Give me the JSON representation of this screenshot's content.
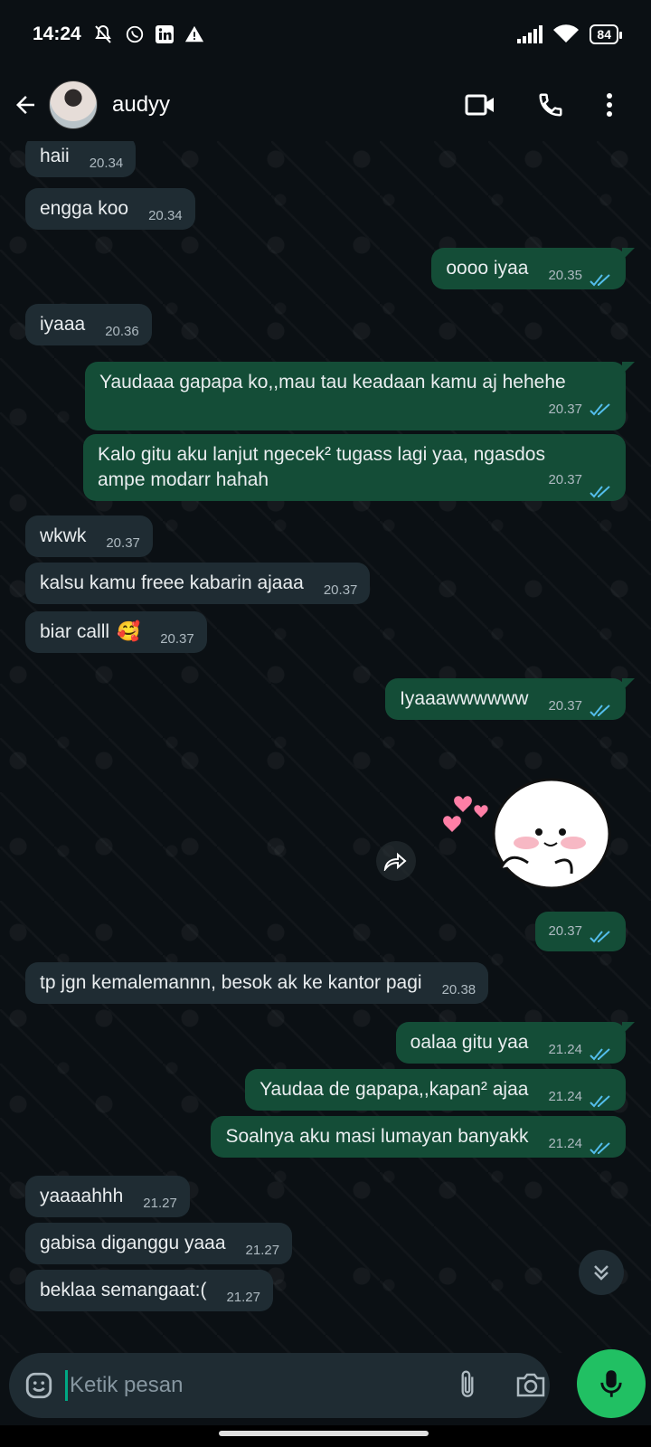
{
  "status_bar": {
    "time": "14:24",
    "battery": "84"
  },
  "header": {
    "contact_name": "audyy"
  },
  "messages": [
    {
      "dir": "in",
      "text": "haii",
      "time": "20.34"
    },
    {
      "dir": "in",
      "text": "engga koo",
      "time": "20.34"
    },
    {
      "dir": "out",
      "text": "oooo iyaa",
      "time": "20.35",
      "read": true
    },
    {
      "dir": "in",
      "text": "iyaaa",
      "time": "20.36"
    },
    {
      "dir": "out",
      "text": "Yaudaaa gapapa ko,,mau tau keadaan kamu aj hehehe",
      "time": "20.37",
      "read": true
    },
    {
      "dir": "out",
      "text": "Kalo gitu aku lanjut ngecek² tugass lagi yaa, ngasdos",
      "text2": "ampe modarr hahah",
      "time": "20.37",
      "read": true
    },
    {
      "dir": "in",
      "text": "wkwk",
      "time": "20.37"
    },
    {
      "dir": "in",
      "text": "kalsu kamu freee kabarin ajaaa",
      "time": "20.37"
    },
    {
      "dir": "in",
      "text": "biar calll",
      "emoji": "🥰",
      "time": "20.37"
    },
    {
      "dir": "out",
      "text": "Iyaaawwwwww",
      "time": "20.37",
      "read": true
    },
    {
      "dir": "out",
      "type": "sticker",
      "time": "20.37",
      "read": true
    },
    {
      "dir": "in",
      "text": "tp jgn kemalemannn, besok ak ke kantor pagi",
      "time": "20.38"
    },
    {
      "dir": "out",
      "text": "oalaa gitu yaa",
      "time": "21.24",
      "read": true
    },
    {
      "dir": "out",
      "text": "Yaudaa de gapapa,,kapan² ajaa",
      "time": "21.24",
      "read": true
    },
    {
      "dir": "out",
      "text": "Soalnya aku masi lumayan banyakk",
      "time": "21.24",
      "read": true
    },
    {
      "dir": "in",
      "text": "yaaaahhh",
      "time": "21.27"
    },
    {
      "dir": "in",
      "text": "gabisa diganggu yaaa",
      "time": "21.27"
    },
    {
      "dir": "in",
      "text": "beklaa semangaat:(",
      "time": "21.27"
    }
  ],
  "composer": {
    "placeholder": "Ketik pesan"
  },
  "colors": {
    "background": "#0b1014",
    "incoming_bubble": "#1f2c33",
    "outgoing_bubble": "#144d37",
    "read_ticks": "#53bdeb",
    "accent": "#21c063"
  },
  "icons": [
    "back-arrow-icon",
    "video-call-icon",
    "phone-icon",
    "more-options-icon",
    "emoji-icon",
    "attach-icon",
    "camera-icon",
    "mic-icon",
    "forward-icon",
    "scroll-down-icon"
  ]
}
